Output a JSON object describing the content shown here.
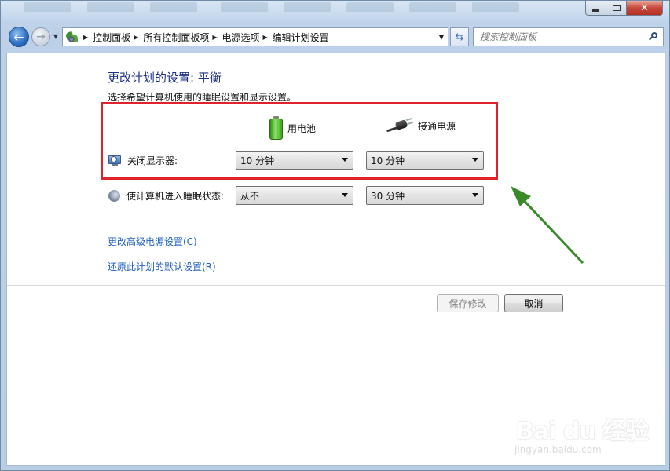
{
  "window": {
    "caption": {
      "minimize": "▭",
      "maximize": "□",
      "close": "✕"
    }
  },
  "address": {
    "crumbs": [
      "控制面板",
      "所有控制面板项",
      "电源选项",
      "编辑计划设置"
    ],
    "separator": "▶"
  },
  "search": {
    "placeholder": "搜索控制面板"
  },
  "page": {
    "title": "更改计划的设置: 平衡",
    "description": "选择希望计算机使用的睡眠设置和显示设置。"
  },
  "columns": {
    "battery": "用电池",
    "plugged_in": "接通电源"
  },
  "settings": [
    {
      "label": "关闭显示器:",
      "battery": "10 分钟",
      "plugged_in": "10 分钟",
      "icon": "monitor-icon"
    },
    {
      "label": "使计算机进入睡眠状态:",
      "battery": "从不",
      "plugged_in": "30 分钟",
      "icon": "moon-icon"
    }
  ],
  "links": {
    "advanced": "更改高级电源设置(C)",
    "restore": "还原此计划的默认设置(R)"
  },
  "buttons": {
    "save": "保存修改",
    "cancel": "取消"
  },
  "watermark": {
    "brand": "Bai du 经验",
    "url": "jingyan.baidu.com"
  },
  "colors": {
    "title_blue": "#1e3287",
    "link_blue": "#1e5fbf",
    "highlight_red": "#e0222d",
    "arrow_green": "#3a8a2a"
  }
}
